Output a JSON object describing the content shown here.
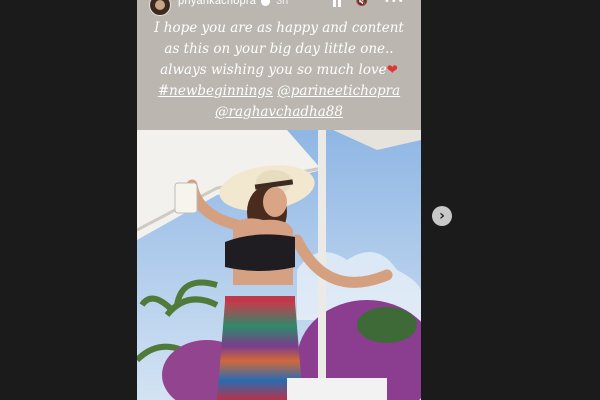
{
  "story": {
    "username": "priyankachopra",
    "time": "3h",
    "caption_line1": "I hope you are as happy and content",
    "caption_line2": "as this on your big day little one..",
    "caption_line3": "always wishing you so much love",
    "heart": "❤",
    "hashtag": "#newbeginnings",
    "mention1": "@parineetichopra",
    "mention2": "@raghavchadha88"
  },
  "controls": {
    "mute_glyph": "🔇",
    "more_glyph": "•••",
    "next_glyph": "›"
  }
}
